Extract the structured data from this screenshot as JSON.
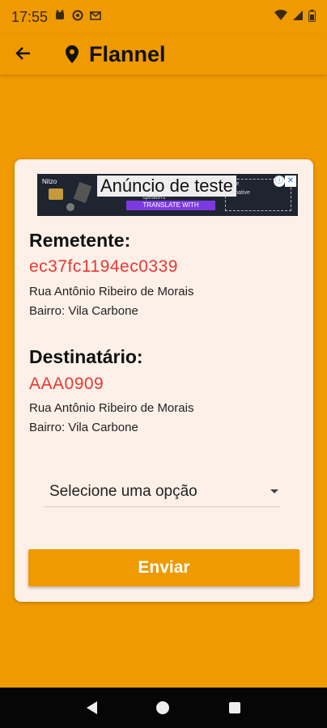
{
  "status_bar": {
    "time": "17:55",
    "left_icons": [
      "notification-icon",
      "nut-icon",
      "mail-icon"
    ],
    "right_icons": [
      "wifi-icon",
      "signal-4g-icon",
      "battery-icon"
    ]
  },
  "app_bar": {
    "back_icon": "arrow-left-icon",
    "pin_icon": "location-pin-icon",
    "title": "Flannel"
  },
  "ad": {
    "brand": "Nitzo",
    "label": "Anúncio de teste",
    "small_text_1": "ine",
    "small_text_2": "speakers",
    "small_text_3": "r native",
    "cta": "TRANSLATE WITH",
    "info_icon": "ⓘ",
    "close_icon": "✕"
  },
  "sender": {
    "heading": "Remetente:",
    "code": "ec37fc1194ec0339",
    "street": "Rua Antônio Ribeiro de Morais",
    "district": "Bairro: Vila Carbone"
  },
  "recipient": {
    "heading": "Destinatário:",
    "code": "AAA0909",
    "street": "Rua Antônio Ribeiro de Morais",
    "district": "Bairro: Vila Carbone"
  },
  "form": {
    "select_value": "Selecione uma opção",
    "submit_label": "Enviar"
  },
  "colors": {
    "primary": "#ee9a00",
    "card": "#fdf0e8",
    "code_red": "#e53935"
  }
}
